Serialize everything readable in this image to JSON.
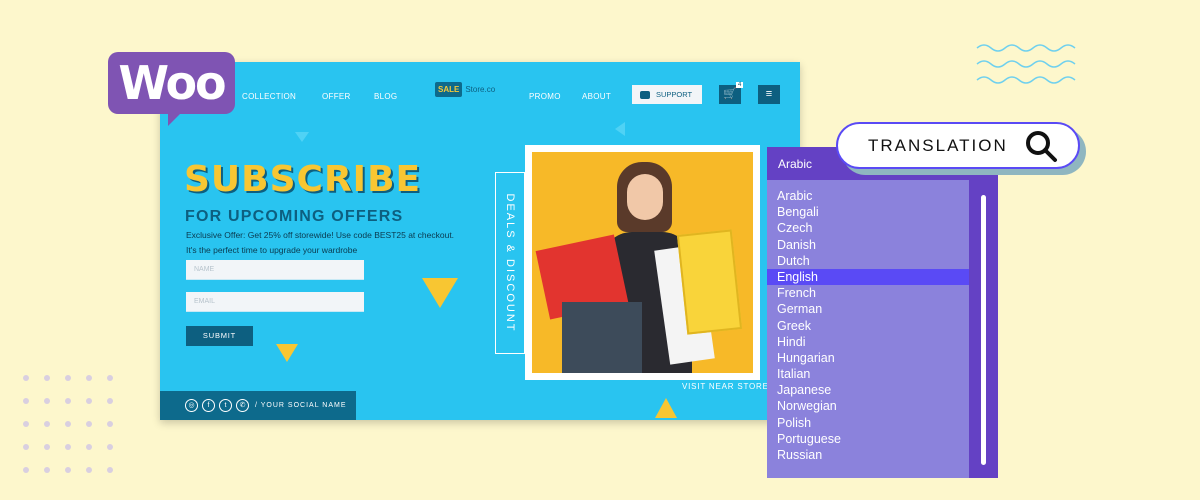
{
  "brand": {
    "logo_text": "Woo",
    "color": "#7f54b3"
  },
  "store": {
    "nav_left": [
      "COLLECTION",
      "OFFER",
      "BLOG"
    ],
    "logo": {
      "sale": "SALE",
      "name": "Store.co"
    },
    "nav_right": [
      "PROMO",
      "ABOUT"
    ],
    "support_label": "SUPPORT",
    "cart_count": "4",
    "headline": "SUBSCRIBE",
    "subheadline": "FOR UPCOMING OFFERS",
    "description_1": "Exclusive Offer: Get 25% off storewide! Use code BEST25 at checkout.",
    "description_2": "It's the perfect time to upgrade your wardrobe",
    "name_placeholder": "NAME",
    "email_placeholder": "EMAIL",
    "submit_label": "SUBMIT",
    "social_name": "/ YOUR SOCIAL NAME",
    "deals_label": "DEALS & DISCOUNT",
    "visit_label": "VISIT NEAR STORE",
    "accent": "#29c4f0"
  },
  "translation": {
    "search_label": "TRANSLATION",
    "selected_value": "Arabic",
    "highlighted": "English",
    "options": [
      "Arabic",
      "Bengali",
      "Czech",
      "Danish",
      "Dutch",
      "English",
      "French",
      "German",
      "Greek",
      "Hindi",
      "Hungarian",
      "Italian",
      "Japanese",
      "Norwegian",
      "Polish",
      "Portuguese",
      "Russian"
    ]
  }
}
